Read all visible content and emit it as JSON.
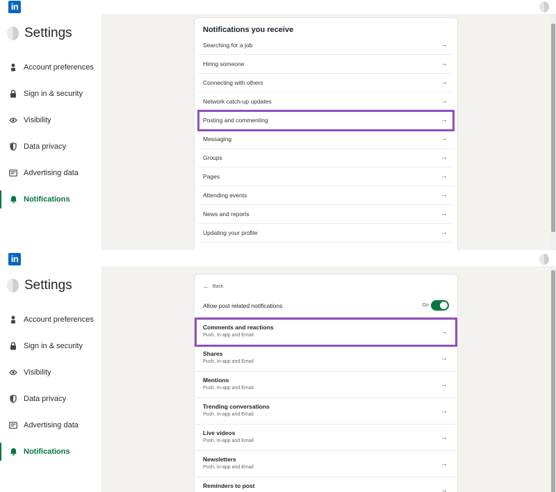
{
  "brand": {
    "logo_text": "in"
  },
  "sidebar": {
    "title": "Settings",
    "items": [
      {
        "label": "Account preferences",
        "icon": "person-icon"
      },
      {
        "label": "Sign in & security",
        "icon": "lock-icon"
      },
      {
        "label": "Visibility",
        "icon": "eye-icon"
      },
      {
        "label": "Data privacy",
        "icon": "shield-icon"
      },
      {
        "label": "Advertising data",
        "icon": "ad-icon"
      },
      {
        "label": "Notifications",
        "icon": "bell-icon",
        "active": true
      }
    ]
  },
  "panel1": {
    "title": "Notifications you receive",
    "items": [
      "Searching for a job",
      "Hiring someone",
      "Connecting with others",
      "Network catch-up updates",
      "Posting and commenting",
      "Messaging",
      "Groups",
      "Pages",
      "Attending events",
      "News and reports",
      "Updating your profile"
    ],
    "highlighted_item": "Posting and commenting"
  },
  "panel2": {
    "back_label": "Back",
    "allow_label": "Allow post related notifications",
    "toggle_state": "On",
    "items": [
      {
        "title": "Comments and reactions",
        "subtitle": "Push, In-app and Email"
      },
      {
        "title": "Shares",
        "subtitle": "Push, In-app and Email"
      },
      {
        "title": "Mentions",
        "subtitle": "Push, In-app and Email"
      },
      {
        "title": "Trending conversations",
        "subtitle": "Push, In-app and Email"
      },
      {
        "title": "Live videos",
        "subtitle": "Push, In-app and Email"
      },
      {
        "title": "Newsletters",
        "subtitle": "Push, In-app and Email"
      },
      {
        "title": "Reminders to post",
        "subtitle": ""
      }
    ],
    "highlighted_item": "Comments and reactions"
  },
  "icons": {
    "arrow": "→",
    "back": "←"
  },
  "colors": {
    "brand": "#0a66c2",
    "active": "#057642",
    "highlight": "#8f4ebf"
  }
}
